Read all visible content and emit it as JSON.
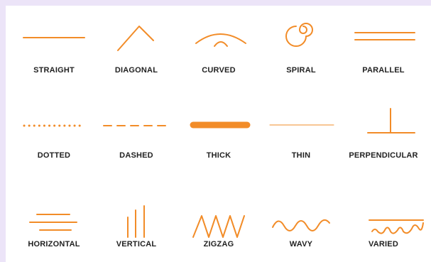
{
  "accent_color": "#f28c28",
  "rows": [
    [
      {
        "label": "STRAIGHT",
        "icon": "straight-line-icon"
      },
      {
        "label": "DIAGONAL",
        "icon": "diagonal-line-icon"
      },
      {
        "label": "CURVED",
        "icon": "curved-line-icon"
      },
      {
        "label": "SPIRAL",
        "icon": "spiral-line-icon"
      },
      {
        "label": "PARALLEL",
        "icon": "parallel-lines-icon"
      }
    ],
    [
      {
        "label": "DOTTED",
        "icon": "dotted-line-icon"
      },
      {
        "label": "DASHED",
        "icon": "dashed-line-icon"
      },
      {
        "label": "THICK",
        "icon": "thick-line-icon"
      },
      {
        "label": "THIN",
        "icon": "thin-line-icon"
      },
      {
        "label": "PERPENDICULAR",
        "icon": "perpendicular-lines-icon"
      }
    ],
    [
      {
        "label": "HORIZONTAL",
        "icon": "horizontal-lines-icon"
      },
      {
        "label": "VERTICAL",
        "icon": "vertical-lines-icon"
      },
      {
        "label": "ZIGZAG",
        "icon": "zigzag-line-icon"
      },
      {
        "label": "WAVY",
        "icon": "wavy-line-icon"
      },
      {
        "label": "VARIED",
        "icon": "varied-line-icon"
      }
    ]
  ]
}
